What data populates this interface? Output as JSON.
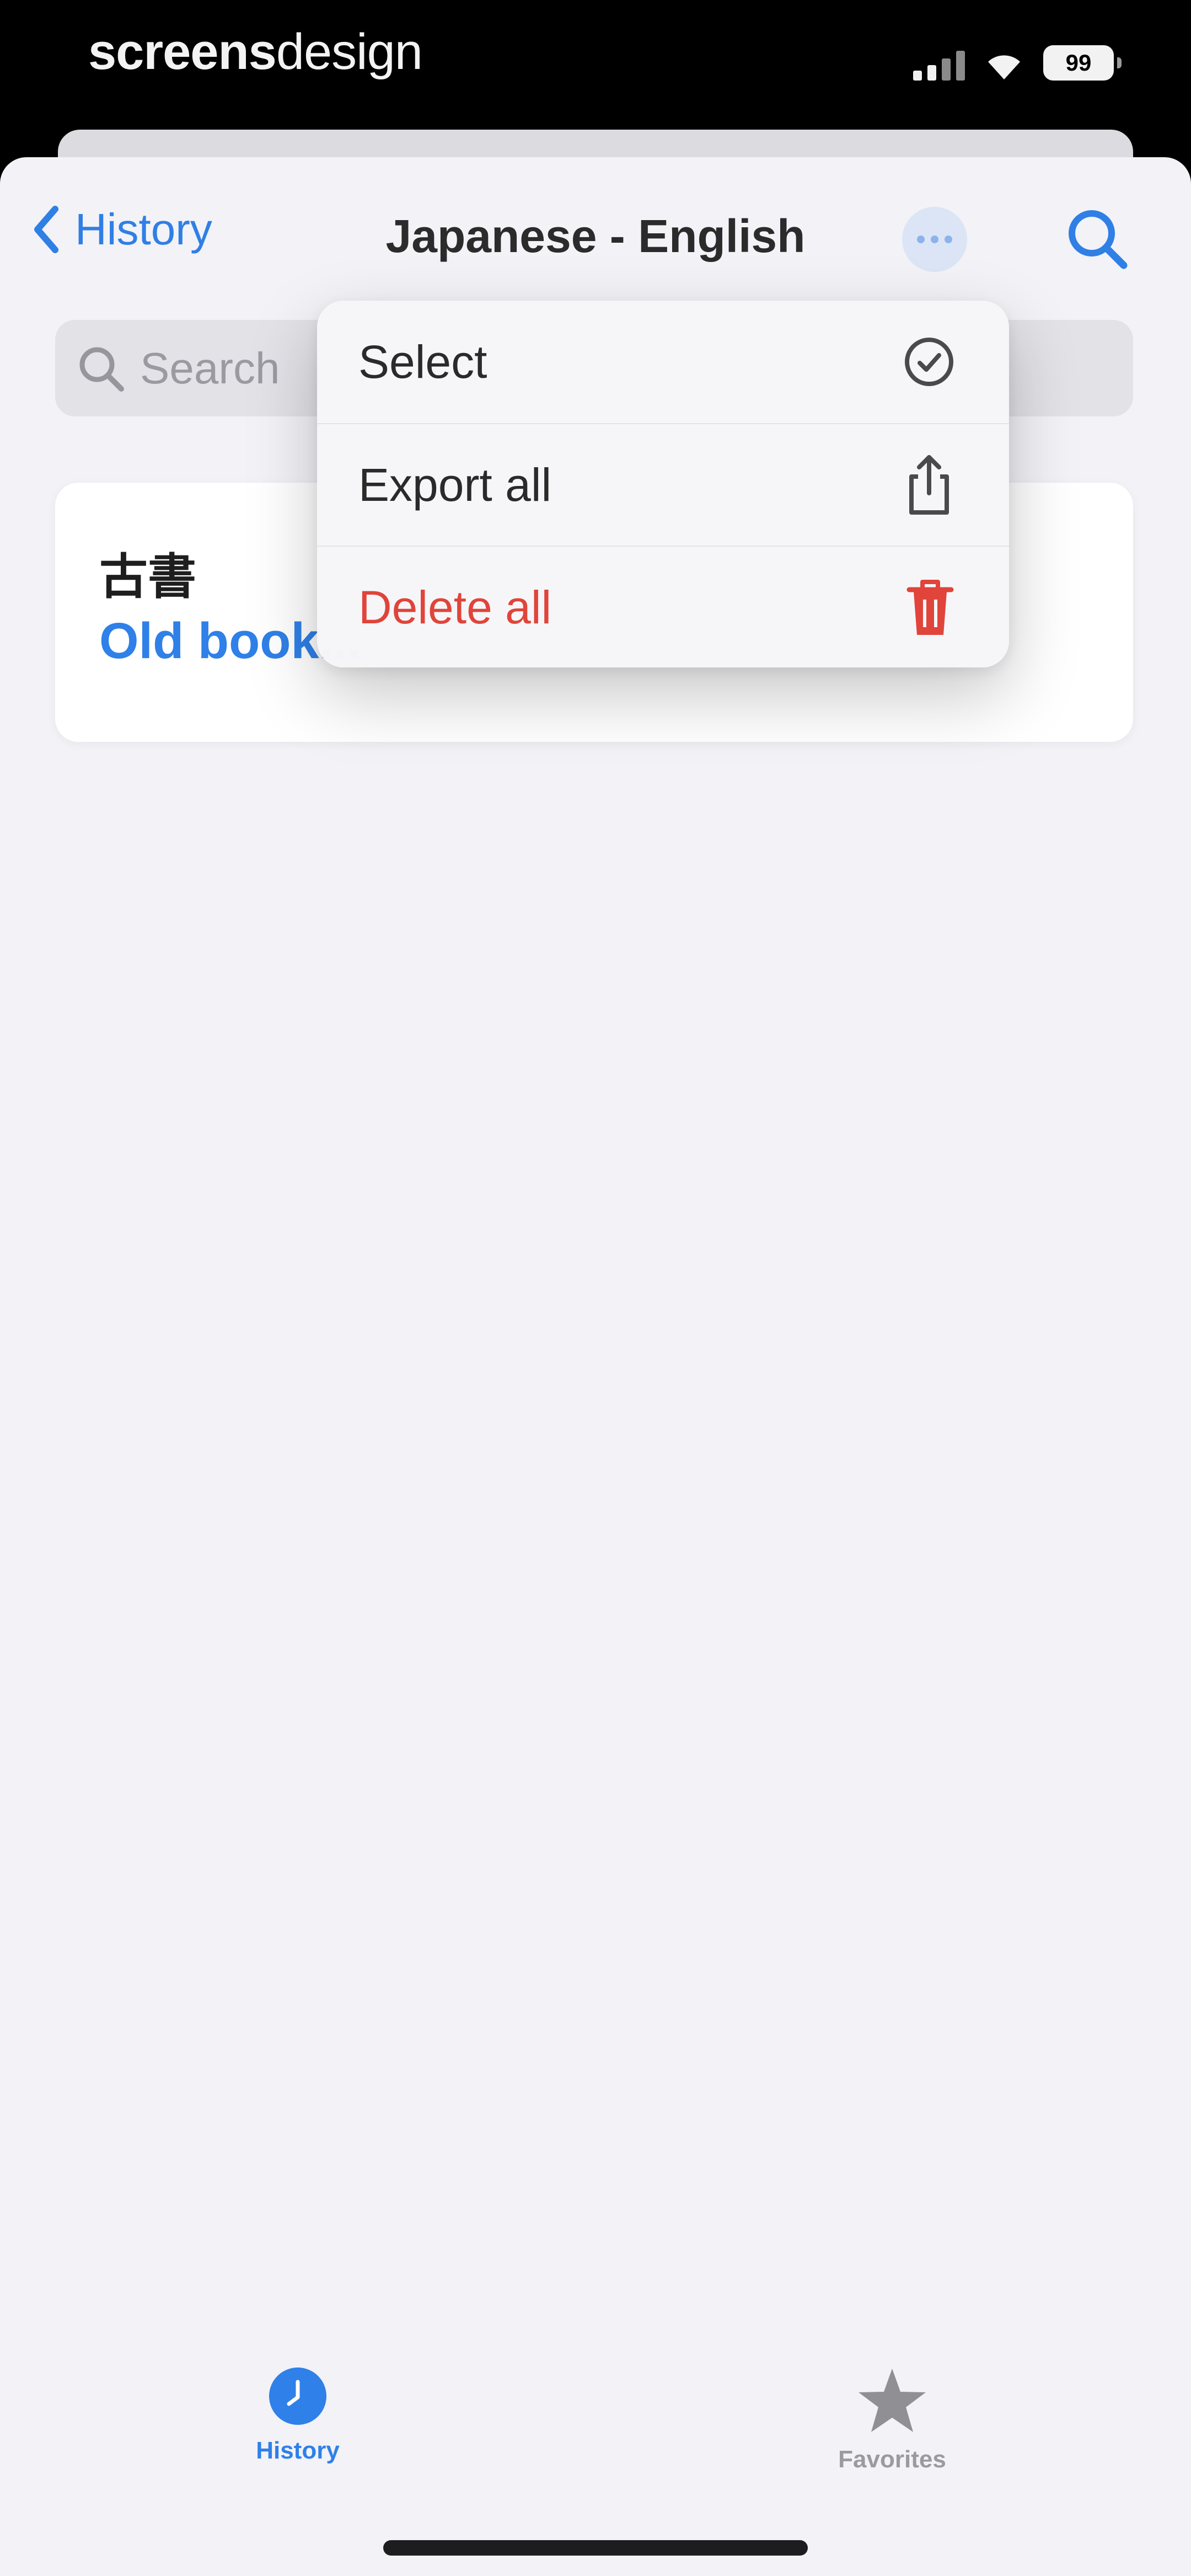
{
  "status_bar": {
    "brand_bold": "screens",
    "brand_light": "design",
    "battery_text": "99"
  },
  "nav": {
    "back_label": "History",
    "title": "Japanese - English"
  },
  "search": {
    "placeholder": "Search"
  },
  "history_items": [
    {
      "source": "古書",
      "translation": "Old book..."
    }
  ],
  "menu": {
    "items": [
      {
        "label": "Select",
        "icon": "checkmark-circle-icon"
      },
      {
        "label": "Export all",
        "icon": "share-icon"
      },
      {
        "label": "Delete all",
        "icon": "trash-icon",
        "color": "#e0443a"
      }
    ]
  },
  "tabs": [
    {
      "label": "History",
      "icon": "history-clock-icon",
      "active": true
    },
    {
      "label": "Favorites",
      "icon": "star-icon",
      "active": false
    }
  ],
  "colors": {
    "accent": "#2f80e8",
    "destructive": "#e0443a",
    "background": "#f2f2f7"
  }
}
